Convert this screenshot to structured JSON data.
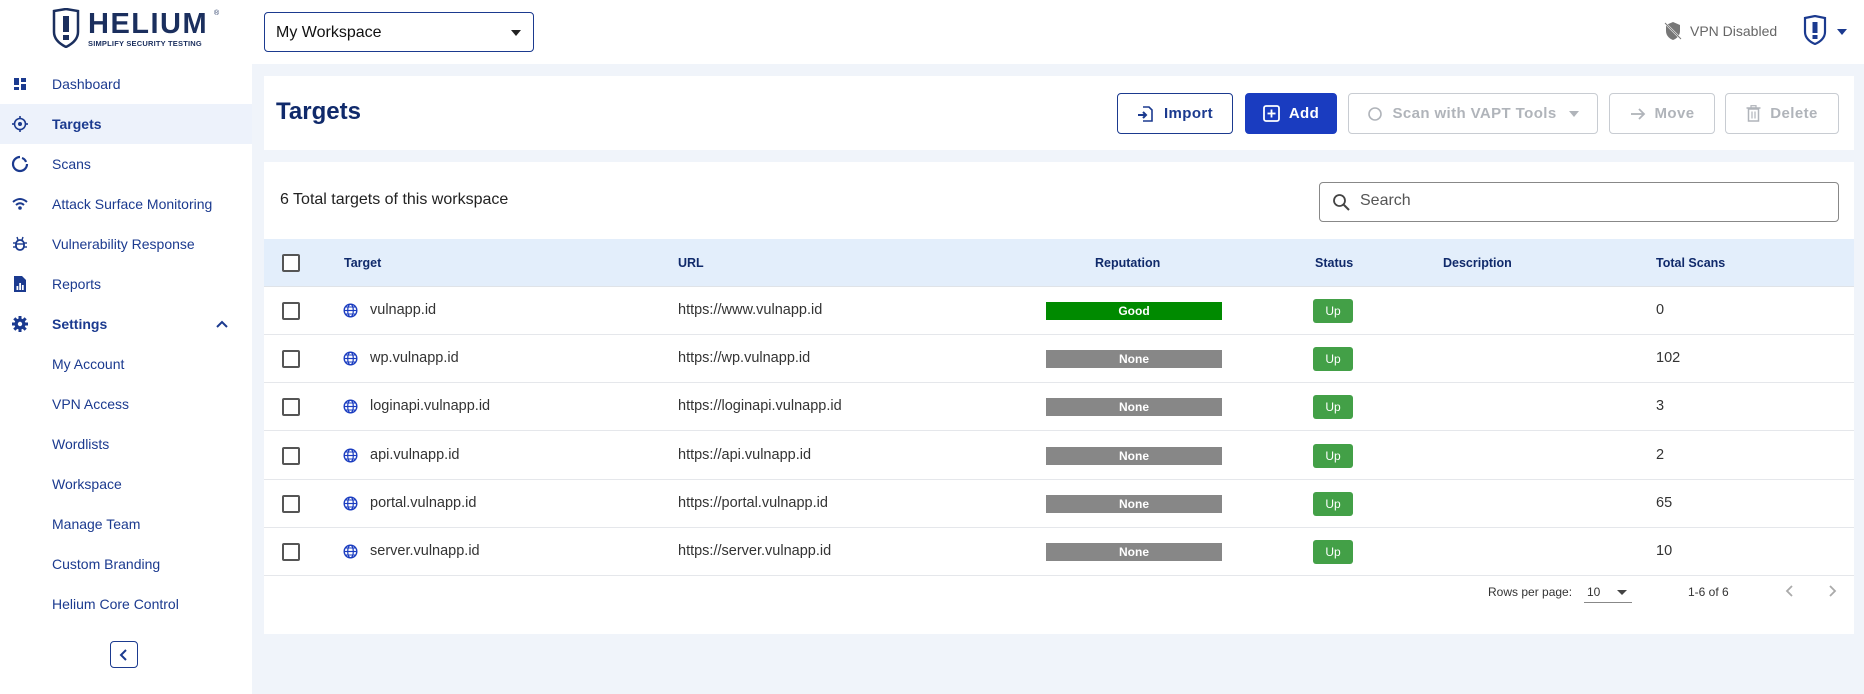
{
  "brand": {
    "name": "HELIUM",
    "reg": "®",
    "tagline": "SIMPLIFY SECURITY TESTING"
  },
  "sidebar": {
    "items": [
      {
        "label": "Dashboard",
        "icon": "dashboard-icon"
      },
      {
        "label": "Targets",
        "icon": "target-icon",
        "active": true
      },
      {
        "label": "Scans",
        "icon": "scan-icon"
      },
      {
        "label": "Attack Surface Monitoring",
        "icon": "wifi-icon"
      },
      {
        "label": "Vulnerability Response",
        "icon": "bug-icon"
      },
      {
        "label": "Reports",
        "icon": "report-icon"
      },
      {
        "label": "Settings",
        "icon": "gear-icon",
        "expanded": true
      }
    ],
    "settings_items": [
      "My Account",
      "VPN Access",
      "Wordlists",
      "Workspace",
      "Manage Team",
      "Custom Branding",
      "Helium Core Control"
    ]
  },
  "topbar": {
    "workspace": "My Workspace",
    "vpn_status": "VPN Disabled"
  },
  "page": {
    "title": "Targets",
    "buttons": {
      "import": "Import",
      "add": "Add",
      "scan": "Scan with VAPT Tools",
      "move": "Move",
      "delete": "Delete"
    }
  },
  "table": {
    "total_text": "6 Total targets of this workspace",
    "search_placeholder": "Search",
    "columns": {
      "target": "Target",
      "url": "URL",
      "reputation": "Reputation",
      "status": "Status",
      "description": "Description",
      "total_scans": "Total Scans"
    },
    "rows": [
      {
        "target": "vulnapp.id",
        "url": "https://www.vulnapp.id",
        "reputation": "Good",
        "status": "Up",
        "description": "",
        "total_scans": "0"
      },
      {
        "target": "wp.vulnapp.id",
        "url": "https://wp.vulnapp.id",
        "reputation": "None",
        "status": "Up",
        "description": "",
        "total_scans": "102"
      },
      {
        "target": "loginapi.vulnapp.id",
        "url": "https://loginapi.vulnapp.id",
        "reputation": "None",
        "status": "Up",
        "description": "",
        "total_scans": "3"
      },
      {
        "target": "api.vulnapp.id",
        "url": "https://api.vulnapp.id",
        "reputation": "None",
        "status": "Up",
        "description": "",
        "total_scans": "2"
      },
      {
        "target": "portal.vulnapp.id",
        "url": "https://portal.vulnapp.id",
        "reputation": "None",
        "status": "Up",
        "description": "",
        "total_scans": "65"
      },
      {
        "target": "server.vulnapp.id",
        "url": "https://server.vulnapp.id",
        "reputation": "None",
        "status": "Up",
        "description": "",
        "total_scans": "10"
      }
    ],
    "footer": {
      "rows_per_page_label": "Rows per page:",
      "rows_per_page": "10",
      "range": "1-6 of 6"
    }
  },
  "colors": {
    "primary": "#1a3cc0",
    "navy": "#102a6b",
    "good": "#008a00",
    "none": "#878787",
    "up": "#43a047"
  }
}
